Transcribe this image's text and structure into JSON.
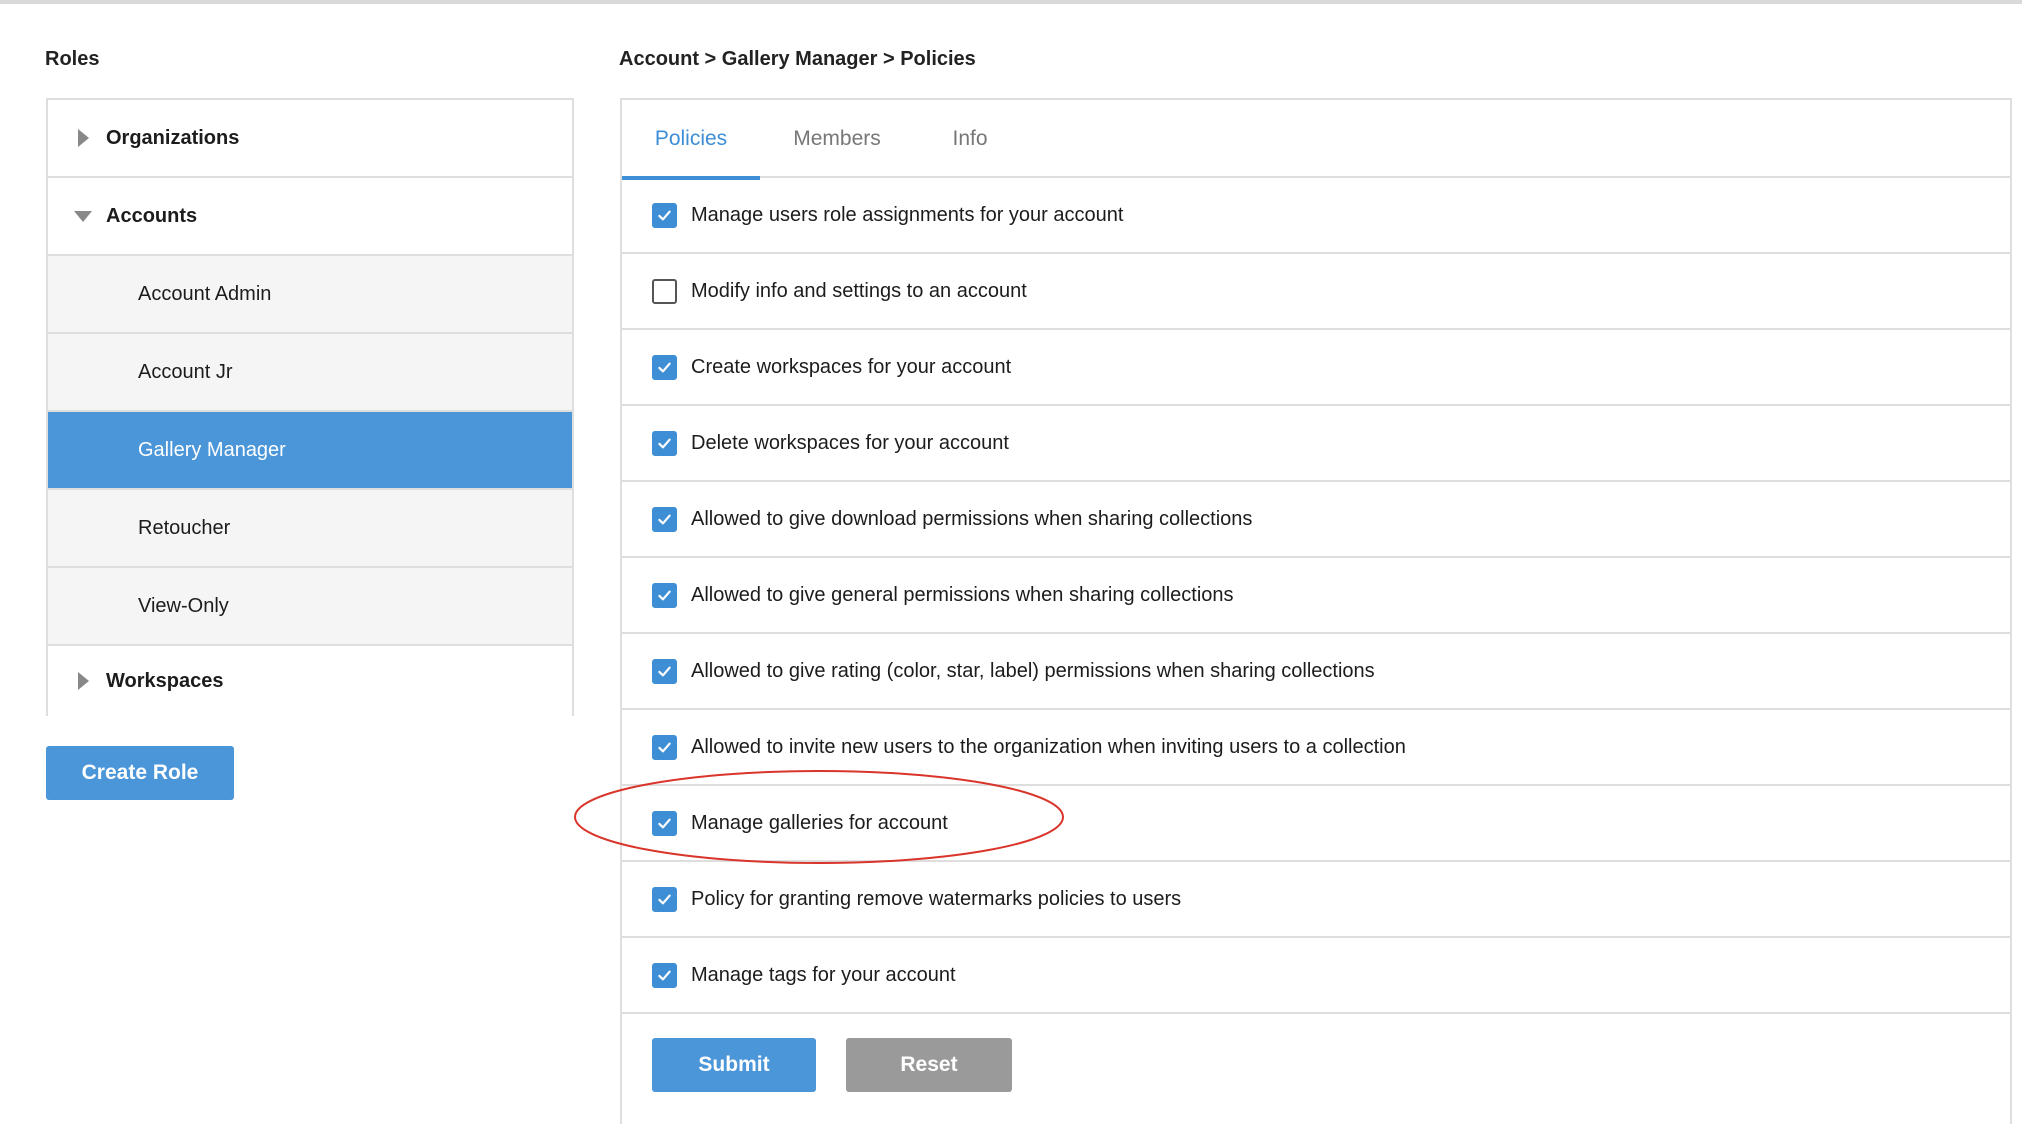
{
  "roles_heading": "Roles",
  "breadcrumb": "Account > Gallery Manager > Policies",
  "roles": [
    {
      "label": "Organizations",
      "kind": "group",
      "expanded": false
    },
    {
      "label": "Accounts",
      "kind": "group",
      "expanded": true
    },
    {
      "label": "Account Admin",
      "kind": "role",
      "selected": false
    },
    {
      "label": "Account Jr",
      "kind": "role",
      "selected": false
    },
    {
      "label": "Gallery Manager",
      "kind": "role",
      "selected": true
    },
    {
      "label": "Retoucher",
      "kind": "role",
      "selected": false
    },
    {
      "label": "View-Only",
      "kind": "role",
      "selected": false
    },
    {
      "label": "Workspaces",
      "kind": "group",
      "expanded": false
    }
  ],
  "create_role_label": "Create Role",
  "tabs": [
    {
      "label": "Policies",
      "active": true
    },
    {
      "label": "Members",
      "active": false
    },
    {
      "label": "Info",
      "active": false
    }
  ],
  "policies": [
    {
      "label": "Manage users role assignments for your account",
      "checked": true
    },
    {
      "label": "Modify info and settings to an account",
      "checked": false
    },
    {
      "label": "Create workspaces for your account",
      "checked": true
    },
    {
      "label": "Delete workspaces for your account",
      "checked": true
    },
    {
      "label": "Allowed to give download permissions when sharing collections",
      "checked": true
    },
    {
      "label": "Allowed to give general permissions when sharing collections",
      "checked": true
    },
    {
      "label": "Allowed to give rating (color, star, label) permissions when sharing collections",
      "checked": true
    },
    {
      "label": "Allowed to invite new users to the organization when inviting users to a collection",
      "checked": true
    },
    {
      "label": "Manage galleries for account",
      "checked": true
    },
    {
      "label": "Policy for granting remove watermarks policies to users",
      "checked": true
    },
    {
      "label": "Manage tags for your account",
      "checked": true
    }
  ],
  "submit_label": "Submit",
  "reset_label": "Reset",
  "colors": {
    "accent": "#3e8ed6",
    "selected_row": "#4a96d9",
    "reset_button": "#9a9a9a",
    "annotation": "#d9352b"
  },
  "icons": {
    "collapsed": "caret-right-icon",
    "expanded": "caret-down-icon",
    "checked": "checkmark-icon"
  }
}
